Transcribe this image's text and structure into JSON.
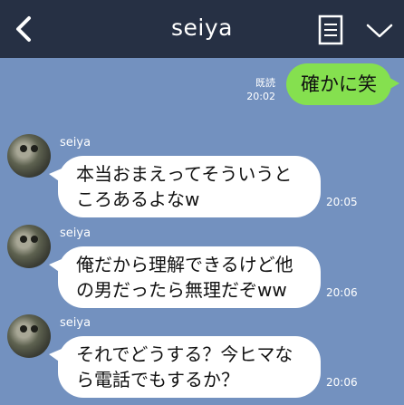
{
  "header": {
    "title": "seiya"
  },
  "outgoing": {
    "read_label": "既読",
    "time": "20:02",
    "text": "確かに笑"
  },
  "messages": [
    {
      "sender": "seiya",
      "line1": "本当おまえってそういうと",
      "line2": "ころあるよなw",
      "time": "20:05"
    },
    {
      "sender": "seiya",
      "line1": "俺だから理解できるけど他",
      "line2": "の男だったら無理だぞww",
      "time": "20:06"
    },
    {
      "sender": "seiya",
      "line1": "それでどうする？今ヒマな",
      "line2": "ら電話でもするか？",
      "time": "20:06"
    }
  ],
  "icons": {
    "back": "chevron-left-icon",
    "menu": "notes-icon",
    "collapse": "chevron-down-icon"
  },
  "colors": {
    "header_bg": "#263044",
    "chat_bg": "#7391bf",
    "outgoing_bubble": "#85e04f",
    "incoming_bubble": "#ffffff"
  }
}
